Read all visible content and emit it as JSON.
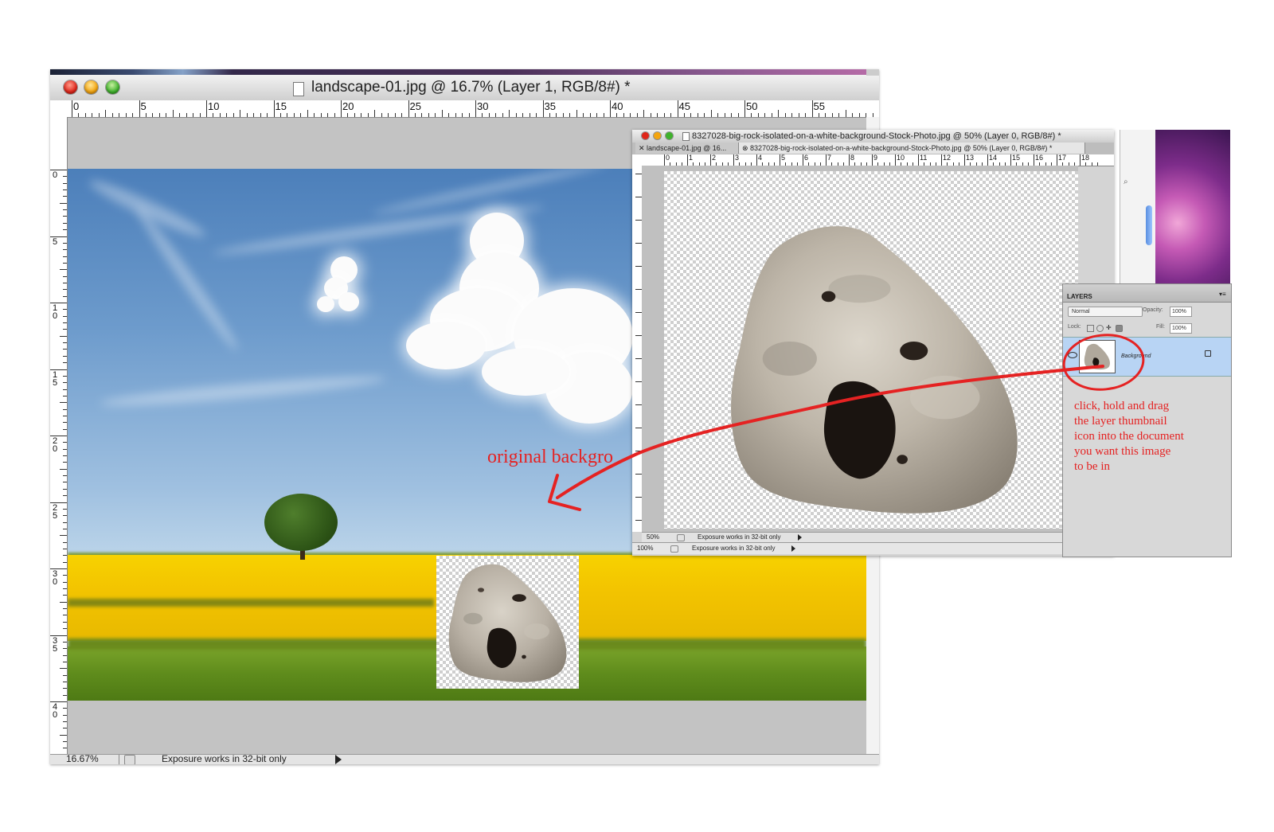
{
  "main_window": {
    "title": "landscape-01.jpg @ 16.7% (Layer 1, RGB/8#) *",
    "h_ruler": [
      "0",
      "5",
      "10",
      "15",
      "20",
      "25",
      "30",
      "35",
      "40",
      "45",
      "50",
      "55"
    ],
    "v_ruler": [
      "0",
      "5",
      "1\n0",
      "1\n5",
      "2\n0",
      "2\n5",
      "3\n0",
      "3\n5",
      "4\n0"
    ],
    "status_zoom": "16.67%",
    "status_message": "Exposure works in 32-bit only"
  },
  "annotation_background": "original backgro",
  "rock_window": {
    "title": "8327028-big-rock-isolated-on-a-white-background-Stock-Photo.jpg @ 50% (Layer 0, RGB/8#) *",
    "tabs": [
      "landscape-01.jpg @ 16...",
      "8327028-big-rock-isolated-on-a-white-background-Stock-Photo.jpg @ 50% (Layer 0, RGB/8#) *"
    ],
    "h_ruler": [
      "0",
      "1",
      "2",
      "3",
      "4",
      "5",
      "6",
      "7",
      "8",
      "9",
      "10",
      "11",
      "12",
      "13",
      "14",
      "15",
      "16",
      "17",
      "18"
    ],
    "status_zoom": "50%",
    "status_message": "Exposure works in 32-bit only",
    "status2_zoom": "100%",
    "status2_message": "Exposure works in 32-bit only"
  },
  "layers_panel": {
    "title": "LAYERS",
    "menu_glyph": "▾≡",
    "blend_mode": "Normal",
    "opacity_label": "Opacity:",
    "opacity_value": "100%",
    "lock_label": "Lock:",
    "fill_label": "Fill:",
    "fill_value": "100%",
    "layer_name": "Background"
  },
  "instructions": [
    "click, hold and drag",
    "the layer thumbnail",
    "icon into  the document",
    "you want this image",
    "to be in"
  ],
  "colors": {
    "annotation_red": "#e52222",
    "layer_selected": "#b8d4f4"
  }
}
